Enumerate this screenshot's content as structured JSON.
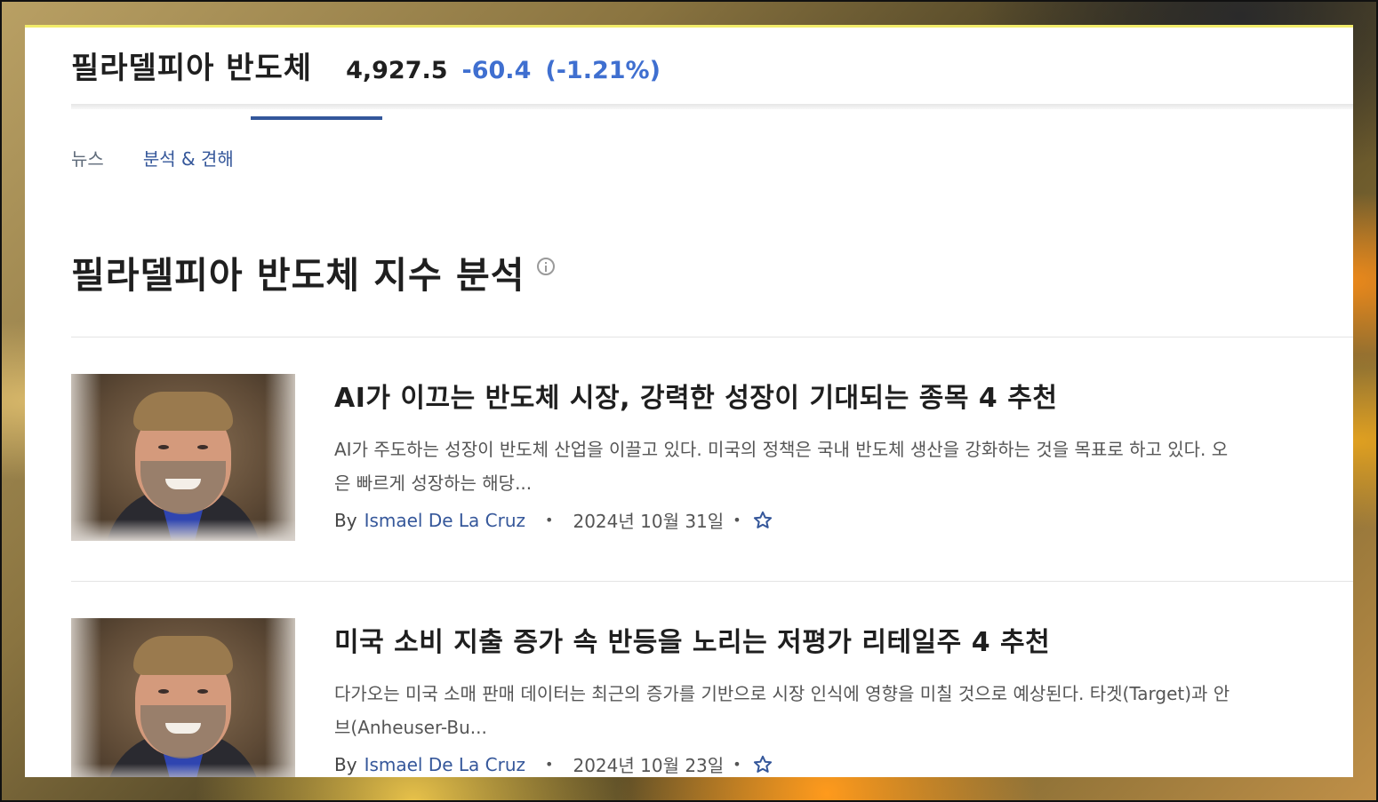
{
  "header": {
    "title": "필라델피아 반도체",
    "price": "4,927.5",
    "change": "-60.4",
    "change_pct": "(-1.21%)"
  },
  "tabs": [
    {
      "label": "뉴스",
      "active": false
    },
    {
      "label": "분석 & 견해",
      "active": true
    }
  ],
  "section": {
    "title": "필라델피아 반도체 지수 분석"
  },
  "articles": [
    {
      "title": "AI가 이끄는 반도체 시장, 강력한 성장이 기대되는 종목 4 추천",
      "summary_line1": "AI가 주도하는 성장이 반도체 산업을 이끌고 있다. 미국의 정책은 국내 반도체 생산을 강화하는 것을 목표로 하고 있다. 오",
      "summary_line2": "은 빠르게 성장하는 해당...",
      "by": "By",
      "author": "Ismael De La Cruz",
      "date": "2024년 10월 31일"
    },
    {
      "title": "미국 소비 지출 증가 속 반등을 노리는 저평가 리테일주 4 추천",
      "summary_line1": "다가오는 미국 소매 판매 데이터는 최근의 증가를 기반으로 시장 인식에 영향을 미칠 것으로 예상된다. 타겟(Target)과 안",
      "summary_line2": "브(Anheuser-Bu...",
      "by": "By",
      "author": "Ismael De La Cruz",
      "date": "2024년 10월 23일"
    }
  ],
  "colors": {
    "accent": "#3f6fd0",
    "link": "#35579a",
    "top_border": "#f2ec6a"
  }
}
